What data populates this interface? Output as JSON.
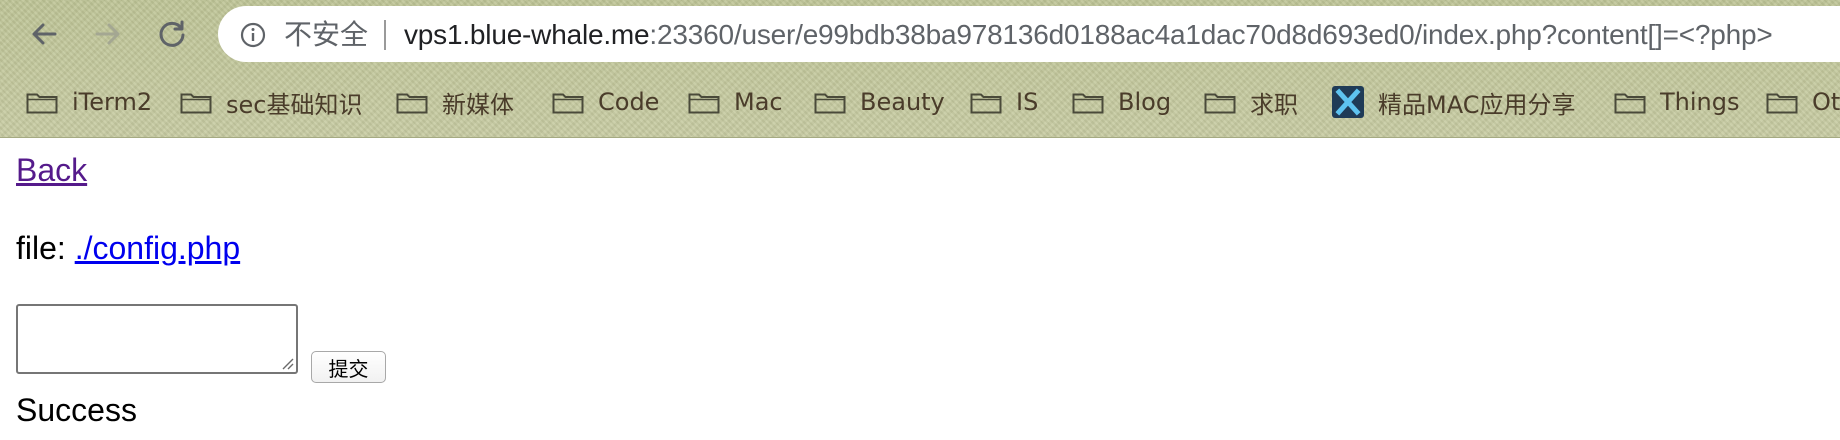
{
  "browser": {
    "security_label": "不安全",
    "url_host": "vps1.blue-whale.me",
    "url_rest": ":23360/user/e99bdb38ba978136d0188ac4a1dac70d8d693ed0/index.php?content[]=<?php>",
    "icons": {
      "back": "back-arrow-icon",
      "forward": "forward-arrow-icon",
      "reload": "reload-icon",
      "info": "info-icon"
    }
  },
  "bookmarks": [
    {
      "label": "iTerm2",
      "icon": "folder-icon"
    },
    {
      "label": "sec基础知识",
      "icon": "folder-icon"
    },
    {
      "label": "新媒体",
      "icon": "folder-icon"
    },
    {
      "label": "Code",
      "icon": "folder-icon"
    },
    {
      "label": "Mac",
      "icon": "folder-icon"
    },
    {
      "label": "Beauty",
      "icon": "folder-icon"
    },
    {
      "label": "IS",
      "icon": "folder-icon"
    },
    {
      "label": "Blog",
      "icon": "folder-icon"
    },
    {
      "label": "求职",
      "icon": "folder-icon"
    },
    {
      "label": "精品MAC应用分享",
      "icon": "x-app-icon"
    },
    {
      "label": "Things",
      "icon": "folder-icon"
    },
    {
      "label": "Ot",
      "icon": "folder-icon"
    }
  ],
  "page": {
    "back_link": "Back",
    "file_label": "file: ",
    "file_link": "./config.php",
    "textarea_value": "",
    "submit_label": "提交",
    "status": "Success"
  },
  "colors": {
    "chrome_bg": "#c4c99c",
    "visited_link": "#551a8b",
    "link": "#0000ee"
  }
}
